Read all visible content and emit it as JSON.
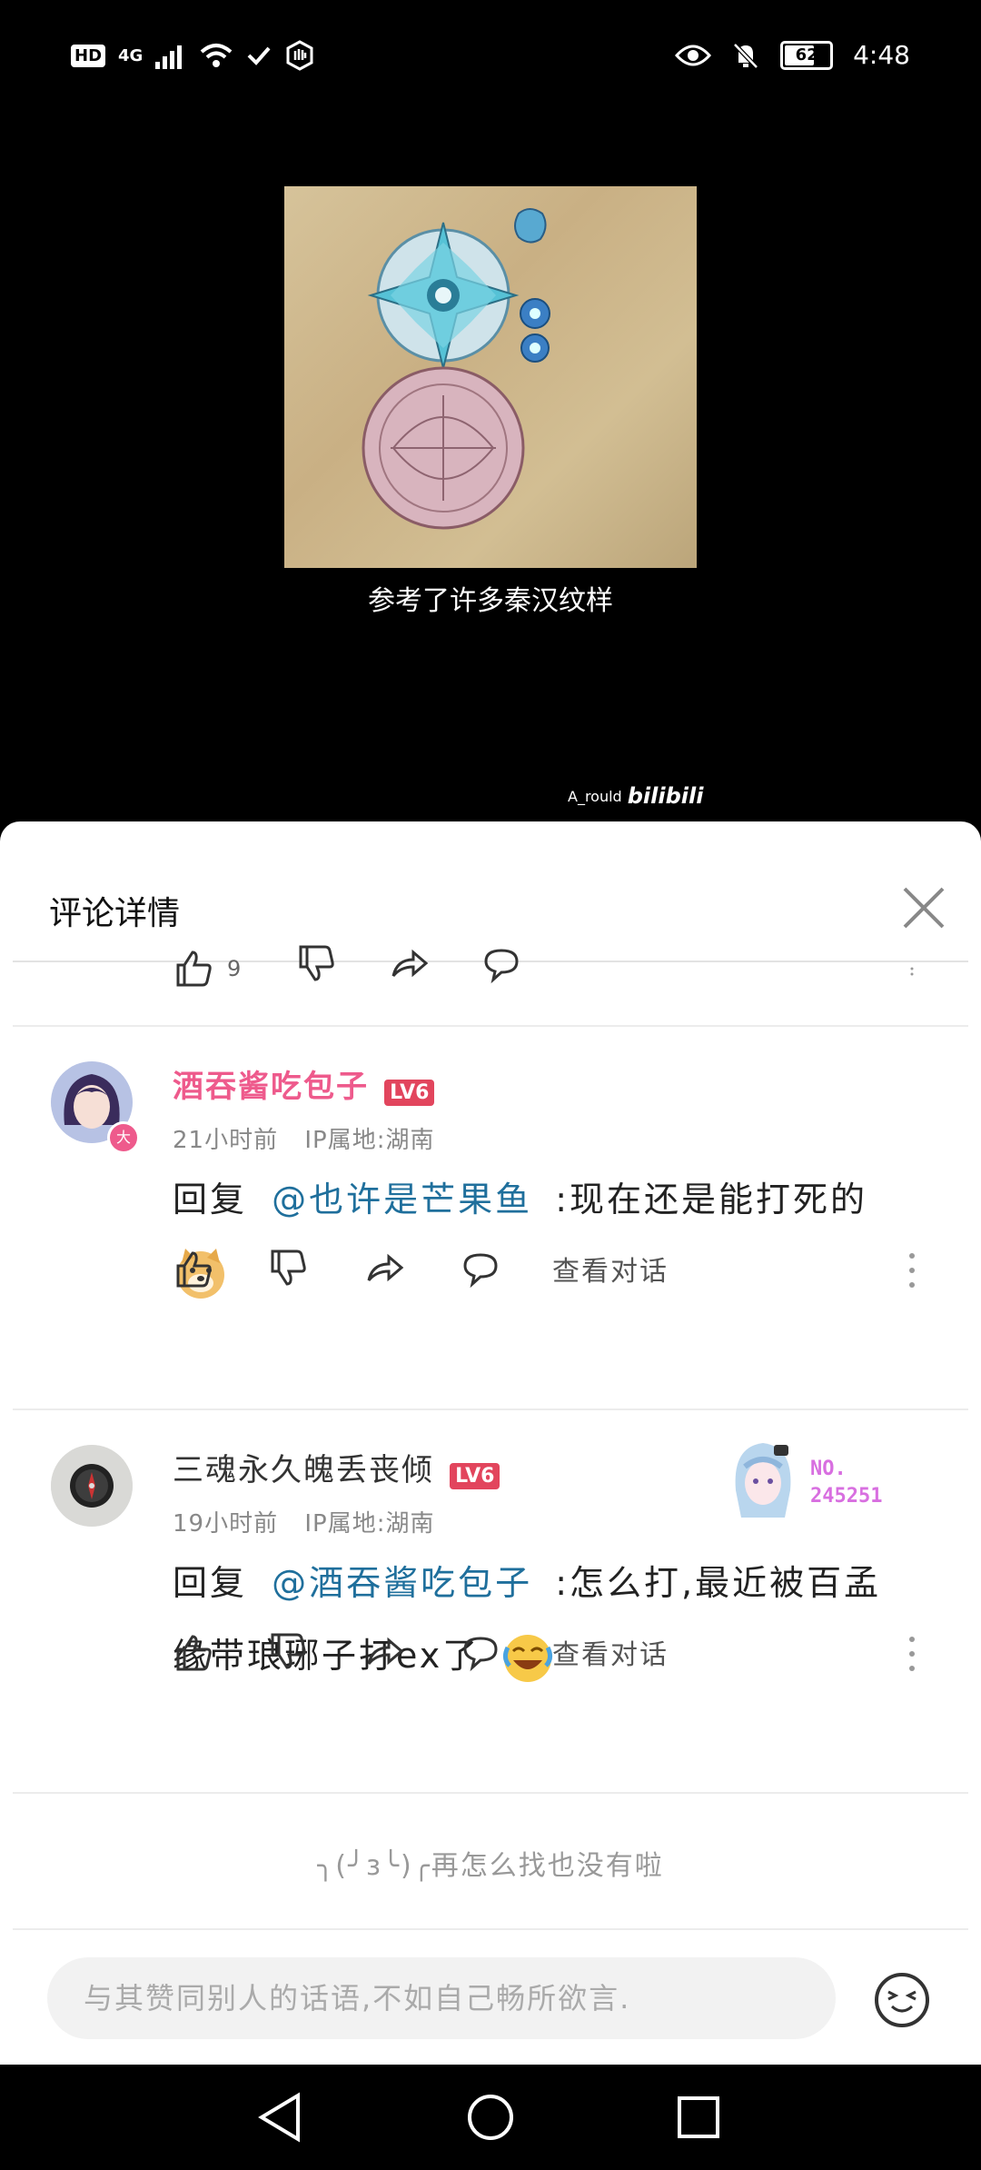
{
  "status_bar": {
    "left_badge": "HD",
    "network": "4G",
    "battery": "62",
    "time": "4:48"
  },
  "video": {
    "subtitle": "参考了许多秦汉纹样",
    "watermark_user": "A_rould",
    "watermark_brand": "bilibili"
  },
  "sheet": {
    "title": "评论详情",
    "top_partial_row": {
      "like_count": "9"
    },
    "comments": [
      {
        "username": "酒吞酱吃包子",
        "level": "LV6",
        "time": "21小时前",
        "ip": "IP属地:湖南",
        "reply_prefix": "回复",
        "mention": "@也许是芒果鱼",
        "body": ":现在还是能打死的",
        "view_dialog": "查看对话",
        "avatar_badge": "大"
      },
      {
        "username": "三魂永久魄丢丧倾",
        "level": "LV6",
        "time": "19小时前",
        "ip": "IP属地:湖南",
        "reply_prefix": "回复",
        "mention": "@酒吞酱吃包子",
        "body_line1": ":怎么打,最近被百孟",
        "body_line2": "缘带琅琊子打ex了",
        "view_dialog": "查看对话",
        "fan_badge_no": "NO.",
        "fan_badge_num": "245251"
      }
    ],
    "end_text": "╮(╯з╰)╭再怎么找也没有啦",
    "input_placeholder": "与其赞同别人的话语,不如自己畅所欲言."
  },
  "colors": {
    "accent_pink": "#ee5a8c",
    "level_red": "#e2455d",
    "mention_blue": "#1f6f9c",
    "fan_badge": "#d86fe0"
  }
}
